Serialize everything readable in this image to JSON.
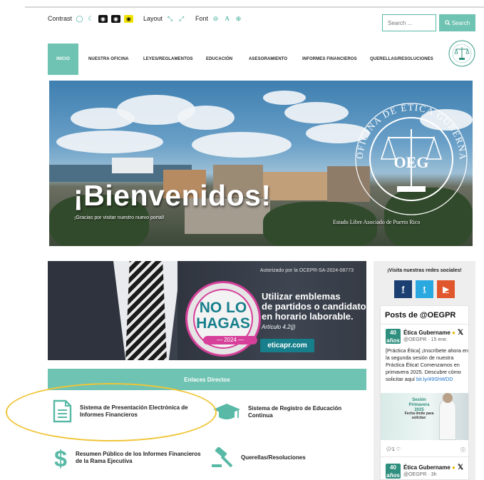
{
  "accessibility": {
    "contrast_label": "Contrast",
    "layout_label": "Layout",
    "font_label": "Font"
  },
  "search": {
    "placeholder": "Search ...",
    "button_label": "Search"
  },
  "nav": {
    "items": [
      "INICIO",
      "NUESTRA OFICINA",
      "LEYES/REGLAMENTOS",
      "EDUCACIÓN",
      "ASESORAMIENTO",
      "INFORMES FINANCIEROS",
      "QUERELLAS/RESOLUCIONES"
    ],
    "active_index": 0
  },
  "hero": {
    "title": "¡Bienvenidos!",
    "subtitle": "¡Gracias por visitar nuestro nuevo portal!",
    "seal_ring_text": "OFICINA DE ÉTICA GUBERNAMENTAL DE PUERTO RICO",
    "seal_initials": "OEG",
    "seal_caption": "Estado Libre Asociado de Puerto Rico"
  },
  "banner": {
    "authorization": "Autorizado por la OCEPR-SA-2024-08773",
    "badge_line1": "NO LO",
    "badge_line2": "HAGAS",
    "badge_year": "— 2024 —",
    "message_lines": [
      "Utilizar emblemas",
      "de partidos o candidatos",
      "en horario laborable."
    ],
    "article": "Artículo 4.2(j)",
    "url": "eticapr.com"
  },
  "direct_links": {
    "header": "Enlaces Directos",
    "items": [
      "Sistema de Presentación Electrónica de Informes Financieros",
      "Sistema de Registro de Educación Continua",
      "Resumen Público de los Informes Financieros de la Rama Ejecutiva",
      "Querellas/Resoluciones"
    ]
  },
  "sidebar": {
    "social_heading": "¡Visita nuestras redes sociales!",
    "social": [
      {
        "name": "facebook",
        "glyph": "f",
        "color": "#1c3f72"
      },
      {
        "name": "twitter",
        "glyph": "t",
        "color": "#2aa9e0"
      },
      {
        "name": "youtube",
        "glyph": "▶",
        "color": "#e0562d"
      }
    ],
    "feed_title": "Posts de @OEGPR",
    "posts": [
      {
        "author": "Ética Gubername",
        "handle": "@OEGPR · 15 ene.",
        "text": "[Práctica Ética] ¡Inscríbete ahora en la segunda sesión de nuestra Práctica Ética! Comenzamos en primavera 2025. Descubre cómo solicitar aquí",
        "link": "bit.ly/49ShWDD",
        "image_label": "Sesión Primavera 2025",
        "image_label2": "Fecha límite para solicitar:",
        "likes": "1"
      },
      {
        "author": "Ética Gubername",
        "handle": "@OEGPR · 3h"
      }
    ],
    "avatar_text": "40 años"
  }
}
